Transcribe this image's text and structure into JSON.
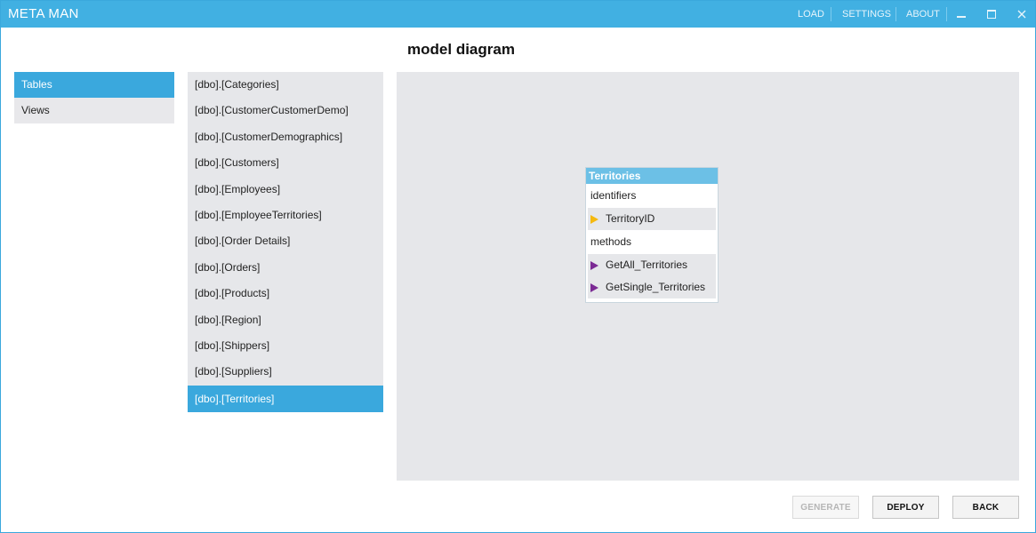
{
  "app": {
    "title": "META MAN"
  },
  "menu": {
    "load": "LOAD",
    "settings": "SETTINGS",
    "about": "ABOUT"
  },
  "page": {
    "title": "model diagram"
  },
  "categories": [
    {
      "label": "Tables",
      "active": true
    },
    {
      "label": "Views",
      "active": false
    }
  ],
  "tables": [
    "[dbo].[Categories]",
    "[dbo].[CustomerCustomerDemo]",
    "[dbo].[CustomerDemographics]",
    "[dbo].[Customers]",
    "[dbo].[Employees]",
    "[dbo].[EmployeeTerritories]",
    "[dbo].[Order Details]",
    "[dbo].[Orders]",
    "[dbo].[Products]",
    "[dbo].[Region]",
    "[dbo].[Shippers]",
    "[dbo].[Suppliers]",
    "[dbo].[Territories]"
  ],
  "selected_table": "[dbo].[Territories]",
  "diagram": {
    "entity": {
      "name": "Territories",
      "identifiers_label": "identifiers",
      "identifiers": [
        "TerritoryID"
      ],
      "methods_label": "methods",
      "methods": [
        "GetAll_Territories",
        "GetSingle_Territories"
      ]
    }
  },
  "buttons": {
    "generate": "GENERATE",
    "deploy": "DEPLOY",
    "back": "BACK"
  },
  "colors": {
    "accent": "#41b0e2",
    "selected": "#3aa8dd",
    "key_marker": "#f5b90f",
    "method_marker": "#7b2a94"
  },
  "icons": {
    "minimize": "minimize-icon",
    "maximize": "maximize-icon",
    "close": "close-icon"
  }
}
